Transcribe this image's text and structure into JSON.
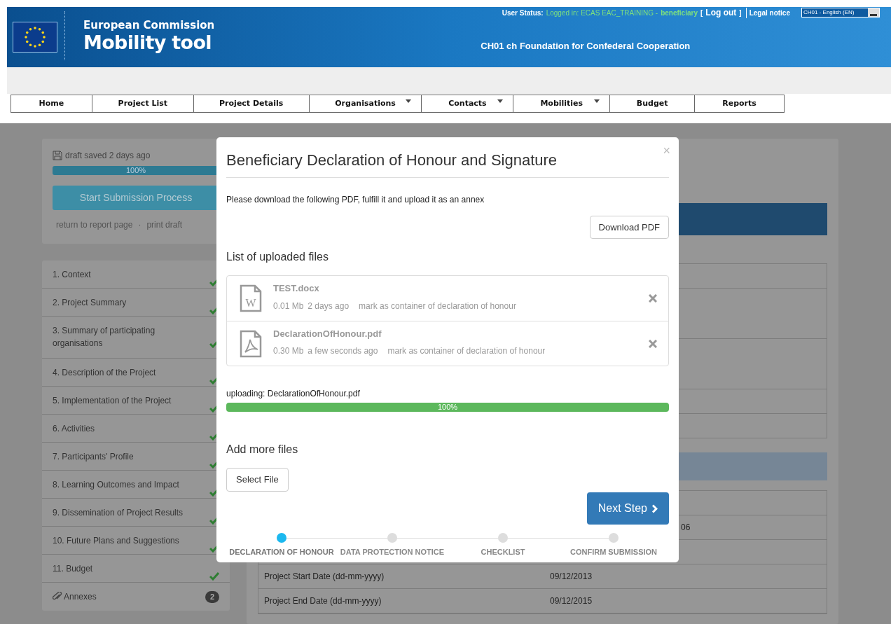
{
  "header": {
    "brand_top": "European Commission",
    "brand": "Mobility tool",
    "status_label": "User Status:",
    "login_text": "Logged in: ECAS EAC_TRAINING - ",
    "role": "beneficiary",
    "bracket_open": "[",
    "logout": "Log out",
    "bracket_close": "]",
    "legal": "Legal notice",
    "language": "CH01 - English (EN)",
    "organisation": "CH01 ch Foundation for Confederal Cooperation"
  },
  "nav": [
    {
      "label": "Home",
      "dropdown": false
    },
    {
      "label": "Project List",
      "dropdown": false
    },
    {
      "label": "Project Details",
      "dropdown": false
    },
    {
      "label": "Organisations",
      "dropdown": true
    },
    {
      "label": "Contacts",
      "dropdown": true
    },
    {
      "label": "Mobilities",
      "dropdown": true
    },
    {
      "label": "Budget",
      "dropdown": false
    },
    {
      "label": "Reports",
      "dropdown": false
    }
  ],
  "sidebar": {
    "draft_status": "draft saved 2 days ago",
    "progress": {
      "level": 1,
      "label": "100%"
    },
    "start_button": "Start Submission Process",
    "links": [
      "return to report page",
      "print draft"
    ],
    "separator": "·",
    "sections": [
      {
        "label": "1. Context",
        "complete": true
      },
      {
        "label": "2. Project Summary",
        "complete": true
      },
      {
        "label": "3. Summary of participating organisations",
        "complete": true
      },
      {
        "label": "4. Description of the Project",
        "complete": true
      },
      {
        "label": "5. Implementation of the Project",
        "complete": true
      },
      {
        "label": "6. Activities",
        "complete": true
      },
      {
        "label": "7. Participants' Profile",
        "complete": true
      },
      {
        "label": "8. Learning Outcomes and Impact",
        "complete": true
      },
      {
        "label": "9. Dissemination of Project Results",
        "complete": true
      },
      {
        "label": "10. Future Plans and Suggestions",
        "complete": true
      },
      {
        "label": "11. Budget",
        "complete": true
      }
    ],
    "annexes": {
      "label": "Annexes",
      "count": "2"
    }
  },
  "main": {
    "fragment": "06",
    "rows": [
      {
        "label": "Project Start Date (dd-mm-yyyy)",
        "value": "09/12/2013"
      },
      {
        "label": "Project End Date (dd-mm-yyyy)",
        "value": "09/12/2015"
      }
    ]
  },
  "modal": {
    "title": "Beneficiary Declaration of Honour and Signature",
    "close": "×",
    "instruction": "Please download the following PDF, fulfill it and upload it as an annex",
    "download_button": "Download PDF",
    "files_heading": "List of uploaded files",
    "files": [
      {
        "kind": "word",
        "icon_letter": "W",
        "name": "TEST.docx",
        "size": "0.01 Mb",
        "age": "2 days ago",
        "action": "mark as container of declaration of honour"
      },
      {
        "kind": "pdf",
        "name": "DeclarationOfHonour.pdf",
        "size": "0.30 Mb",
        "age": "a few seconds ago",
        "action": "mark as container of declaration of honour"
      }
    ],
    "upload": {
      "label": "uploading: DeclarationOfHonour.pdf",
      "level": 1,
      "percent": "100%"
    },
    "add_heading": "Add more files",
    "select_button": "Select File",
    "next_button": "Next Step",
    "steps": [
      {
        "label": "DECLARATION OF HONOUR",
        "selected": true
      },
      {
        "label": "DATA PROTECTION NOTICE",
        "selected": false
      },
      {
        "label": "CHECKLIST",
        "selected": false
      },
      {
        "label": "CONFIRM SUBMISSION",
        "selected": false
      }
    ]
  }
}
